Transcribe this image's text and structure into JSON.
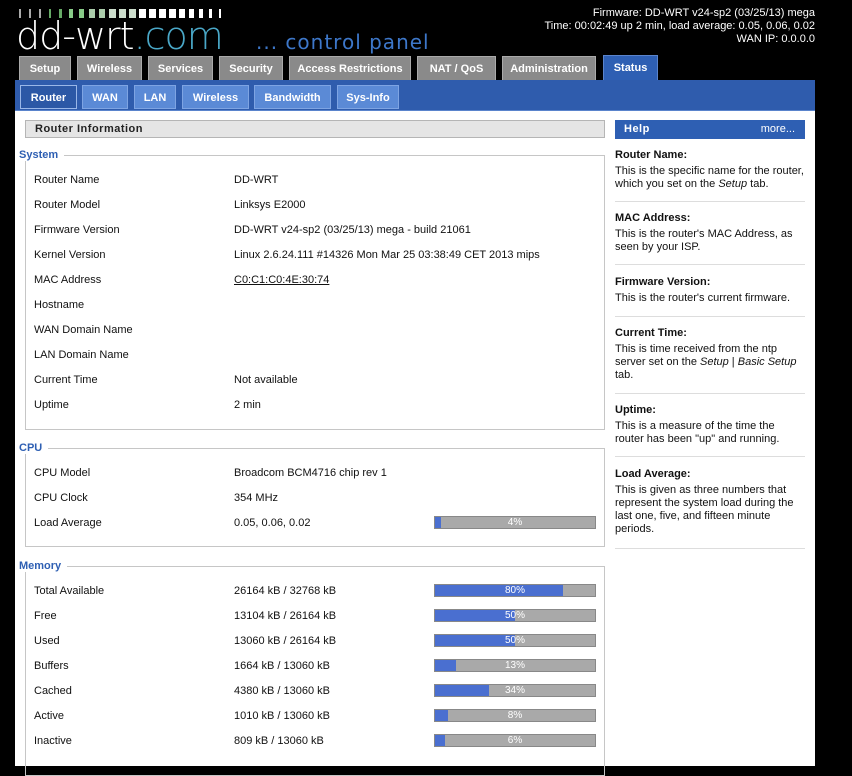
{
  "header": {
    "logo_main": "dd-wrt",
    "logo_com": ".com",
    "logo_sub": "... control panel",
    "firmware_line": "Firmware: DD-WRT v24-sp2 (03/25/13) mega",
    "time_line": "Time: 00:02:49 up 2 min, load average: 0.05, 0.06, 0.02",
    "wan_line": "WAN IP: 0.0.0.0"
  },
  "main_tabs": [
    "Setup",
    "Wireless",
    "Services",
    "Security",
    "Access Restrictions",
    "NAT / QoS",
    "Administration",
    "Status"
  ],
  "sub_tabs": [
    "Router",
    "WAN",
    "LAN",
    "Wireless",
    "Bandwidth",
    "Sys-Info"
  ],
  "page_title": "Router Information",
  "system": {
    "legend": "System",
    "rows": [
      {
        "label": "Router Name",
        "value": "DD-WRT"
      },
      {
        "label": "Router Model",
        "value": "Linksys E2000"
      },
      {
        "label": "Firmware Version",
        "value": "DD-WRT v24-sp2 (03/25/13) mega - build 21061"
      },
      {
        "label": "Kernel Version",
        "value": "Linux 2.6.24.111 #14326 Mon Mar 25 03:38:49 CET 2013 mips"
      },
      {
        "label": "MAC Address",
        "value": "C0:C1:C0:4E:30:74"
      },
      {
        "label": "Hostname",
        "value": ""
      },
      {
        "label": "WAN Domain Name",
        "value": ""
      },
      {
        "label": "LAN Domain Name",
        "value": ""
      },
      {
        "label": "Current Time",
        "value": "Not available"
      },
      {
        "label": "Uptime",
        "value": "2 min"
      }
    ]
  },
  "cpu": {
    "legend": "CPU",
    "rows": [
      {
        "label": "CPU Model",
        "value": "Broadcom BCM4716 chip rev 1"
      },
      {
        "label": "CPU Clock",
        "value": "354 MHz"
      },
      {
        "label": "Load Average",
        "value": "0.05, 0.06, 0.02",
        "percent": 4,
        "percent_label": "4%"
      }
    ]
  },
  "memory": {
    "legend": "Memory",
    "rows": [
      {
        "label": "Total Available",
        "value": "26164 kB / 32768 kB",
        "percent": 80,
        "percent_label": "80%"
      },
      {
        "label": "Free",
        "value": "13104 kB / 26164 kB",
        "percent": 50,
        "percent_label": "50%"
      },
      {
        "label": "Used",
        "value": "13060 kB / 26164 kB",
        "percent": 50,
        "percent_label": "50%"
      },
      {
        "label": "Buffers",
        "value": "1664 kB / 13060 kB",
        "percent": 13,
        "percent_label": "13%"
      },
      {
        "label": "Cached",
        "value": "4380 kB / 13060 kB",
        "percent": 34,
        "percent_label": "34%"
      },
      {
        "label": "Active",
        "value": "1010 kB / 13060 kB",
        "percent": 8,
        "percent_label": "8%"
      },
      {
        "label": "Inactive",
        "value": "809 kB / 13060 kB",
        "percent": 6,
        "percent_label": "6%"
      }
    ]
  },
  "help": {
    "title": "Help",
    "more": "more...",
    "items": [
      {
        "title": "Router Name:",
        "text_html": "This is the specific name for the router, which you set on the <i>Setup</i> tab."
      },
      {
        "title": "MAC Address:",
        "text_html": "This is the router's MAC Address, as seen by your ISP."
      },
      {
        "title": "Firmware Version:",
        "text_html": "This is the router's current firmware."
      },
      {
        "title": "Current Time:",
        "text_html": "This is time received from the ntp server set on the <i>Setup</i> | <i>Basic Setup</i> tab."
      },
      {
        "title": "Uptime:",
        "text_html": "This is a measure of the time the router has been \"up\" and running."
      },
      {
        "title": "Load Average:",
        "text_html": "This is given as three numbers that represent the system load during the last one, five, and fifteen minute periods."
      }
    ]
  }
}
